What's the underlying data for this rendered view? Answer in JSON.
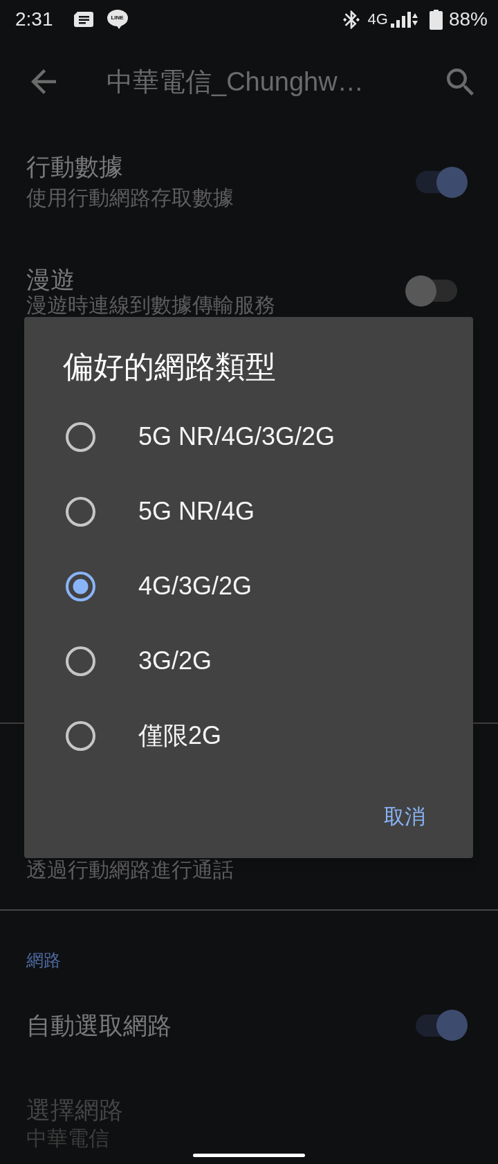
{
  "status_bar": {
    "time": "2:31",
    "app_logo": "LINE",
    "network_type": "4G",
    "battery": "88%"
  },
  "app_bar": {
    "title": "中華電信_Chunghw…"
  },
  "settings_top": [
    {
      "kind": "toggle",
      "title": "行動數據",
      "subtitle": "使用行動網路存取數據",
      "on": true
    },
    {
      "kind": "toggle",
      "title": "漫遊",
      "subtitle": "漫遊時連線到數據傳輸服務",
      "on": false
    }
  ],
  "settings_bottom": {
    "partial_subtitle": "透過行動網路進行通話",
    "section_header": "網路",
    "rows": [
      {
        "kind": "toggle",
        "title": "自動選取網路",
        "on": true,
        "disabled": false
      },
      {
        "kind": "value",
        "title": "選擇網路",
        "subtitle": "中華電信",
        "disabled": true
      }
    ]
  },
  "dialog": {
    "title": "偏好的網路類型",
    "options": [
      {
        "label": "5G NR/4G/3G/2G",
        "selected": false
      },
      {
        "label": "5G NR/4G",
        "selected": false
      },
      {
        "label": "4G/3G/2G",
        "selected": true
      },
      {
        "label": "3G/2G",
        "selected": false
      },
      {
        "label": "僅限2G",
        "selected": false
      }
    ],
    "buttons": [
      "取消"
    ]
  }
}
